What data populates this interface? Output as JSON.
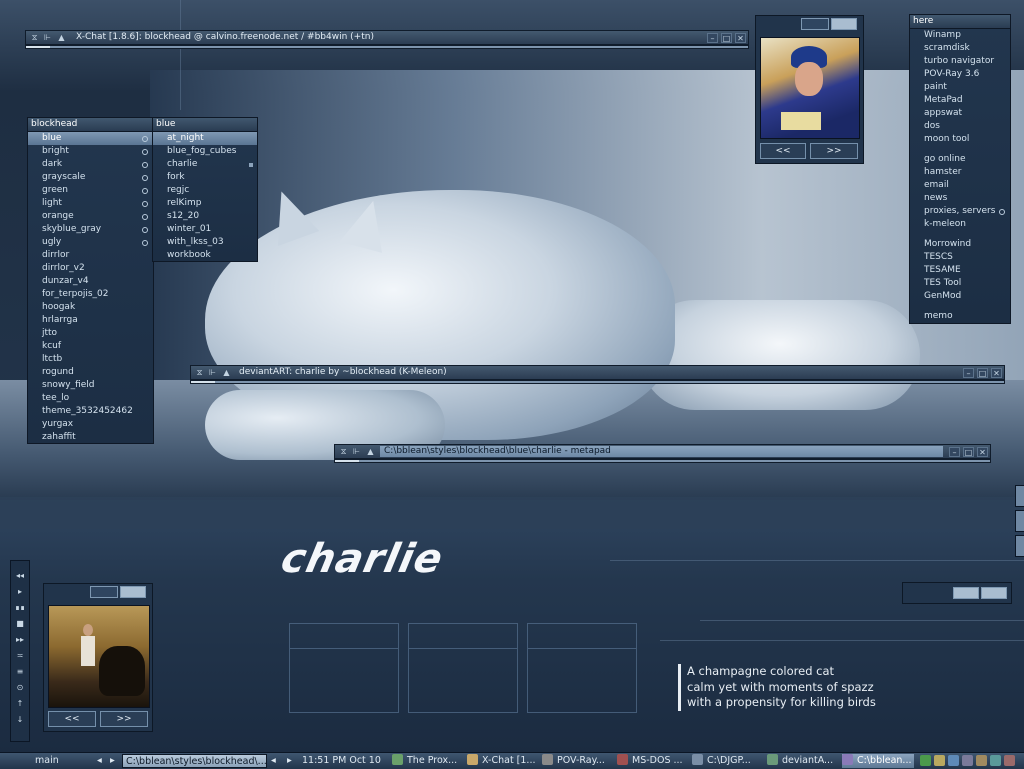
{
  "xchat": {
    "title": "X-Chat [1.8.6]: blockhead @ calvino.freenode.net / #bb4win (+tn)"
  },
  "menu_blockhead": {
    "title": "blockhead",
    "items": [
      "blue",
      "bright",
      "dark",
      "grayscale",
      "green",
      "light",
      "orange",
      "skyblue_gray",
      "ugly",
      "dirrlor",
      "dirrlor_v2",
      "dunzar_v4",
      "for_terpojis_02",
      "hoogak",
      "hrlarrga",
      "jtto",
      "kcuf",
      "ltctb",
      "rogund",
      "snowy_field",
      "tee_lo",
      "theme_3532452462",
      "yurgax",
      "zahaffit"
    ],
    "submenu_count": 9,
    "selected": "blue"
  },
  "menu_blue": {
    "title": "blue",
    "items": [
      "at_night",
      "blue_fog_cubes",
      "charlie",
      "fork",
      "regjc",
      "relKimp",
      "s12_20",
      "winter_01",
      "with_lkss_03",
      "workbook"
    ],
    "selected": "at_night"
  },
  "menu_here": {
    "title": "here",
    "groups": [
      [
        "Winamp",
        "scramdisk",
        "turbo navigator",
        "POV-Ray 3.6",
        "paint",
        "MetaPad",
        "appswat",
        "dos",
        "moon tool"
      ],
      [
        "go online",
        "hamster",
        "email",
        "news",
        "proxies, servers",
        "k-meleon"
      ],
      [
        "Morrowind",
        "TESCS",
        "TESAME",
        "TES Tool",
        "GenMod"
      ],
      [
        "memo"
      ]
    ]
  },
  "kmeleon": {
    "title": "deviantART: charlie by ~blockhead (K-Meleon)"
  },
  "metapad": {
    "title": "C:\\bblean\\styles\\blockhead\\blue\\charlie - metapad"
  },
  "viewer_top": {
    "prev": "<<",
    "next": ">>"
  },
  "viewer_bottom": {
    "prev": "<<",
    "next": ">>"
  },
  "wallpaper": {
    "logo": "charlie",
    "quote": [
      "A champagne colored cat",
      "calm yet with moments of spazz",
      "with a propensity for killing birds"
    ]
  },
  "taskbar": {
    "workspace": "main",
    "workspace_prev": "◂",
    "workspace_next": "▸",
    "current_window": "C:\\bblean\\styles\\blockhead\\...",
    "clock_prev": "◂",
    "clock_next": "▸",
    "clock": "11:51 PM Oct 10",
    "tasks": [
      {
        "label": "The Prox...",
        "color": "#6aa06a"
      },
      {
        "label": "X-Chat [1...",
        "color": "#c9a86a"
      },
      {
        "label": "POV-Ray...",
        "color": "#8a8a8a"
      },
      {
        "label": "MS-DOS ...",
        "color": "#a05050"
      },
      {
        "label": "C:\\DJGP...",
        "color": "#7a8ea6"
      },
      {
        "label": "deviantA...",
        "color": "#6a9a7a"
      },
      {
        "label": "C:\\bblean...",
        "color": "#8a7ab8"
      }
    ],
    "tray_colors": [
      "#4b9a4b",
      "#b8a860",
      "#5e8ab8",
      "#7a7a9a",
      "#a08a60",
      "#5a9a9a",
      "#9a6a6a"
    ]
  },
  "media_controls": [
    "◂◂",
    "▸",
    "∎∎",
    "■",
    "▸▸",
    "≍",
    "≡",
    "⊙",
    "↑",
    "↓"
  ]
}
